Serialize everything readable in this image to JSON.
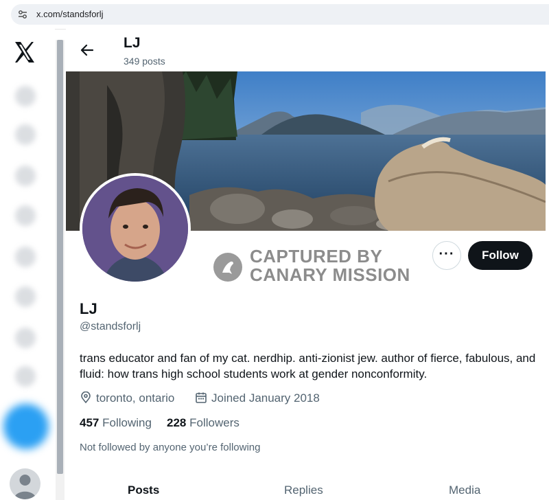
{
  "browser": {
    "url": "x.com/standsforlj"
  },
  "header": {
    "name": "LJ",
    "posts_count": "349 posts"
  },
  "profile": {
    "display_name": "LJ",
    "handle": "@standsforlj",
    "bio": "trans educator and fan of my cat. nerdhip. anti-zionist jew. author of fierce, fabulous, and fluid: how trans high school students work at gender nonconformity.",
    "location": "toronto, ontario",
    "joined": "Joined January 2018",
    "following_count": "457",
    "following_label": "Following",
    "followers_count": "228",
    "followers_label": "Followers",
    "not_followed_text": "Not followed by anyone you’re following"
  },
  "actions": {
    "more_label": "···",
    "follow_label": "Follow"
  },
  "watermark": {
    "line1": "CAPTURED BY",
    "line2": "CANARY MISSION"
  },
  "tabs": [
    {
      "label": "Posts",
      "active": true
    },
    {
      "label": "Replies",
      "active": false
    },
    {
      "label": "Media",
      "active": false
    }
  ],
  "colors": {
    "text": "#0f1419",
    "secondary": "#536471",
    "accent": "#1d9bf0",
    "follow_bg": "#0f1419"
  },
  "icons": [
    "site-settings-icon",
    "x-logo-icon",
    "back-arrow-icon",
    "location-icon",
    "calendar-icon",
    "more-icon",
    "canary-mission-seal-icon"
  ]
}
